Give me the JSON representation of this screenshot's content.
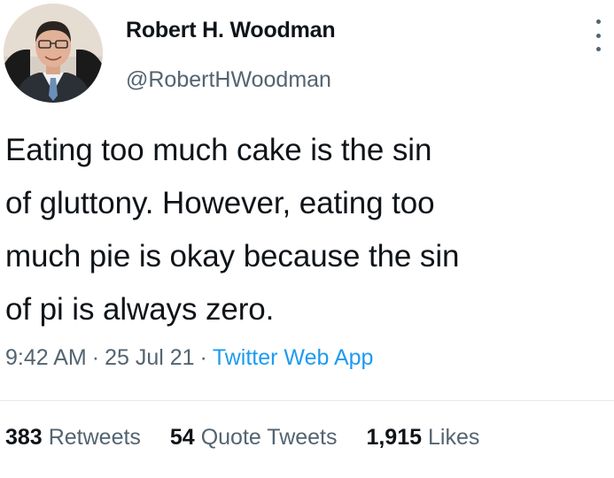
{
  "author": {
    "display_name": "Robert H. Woodman",
    "handle": "@RobertHWoodman",
    "avatar_icon": "profile-photo"
  },
  "tweet": {
    "lines": [
      "Eating too much cake is the sin",
      "of gluttony. However, eating too",
      "much pie is okay because the sin",
      "of pi is always zero."
    ],
    "time": "9:42 AM",
    "date": "25 Jul 21",
    "separator": "·",
    "source": "Twitter Web App"
  },
  "stats": {
    "retweets_count": "383",
    "retweets_label": "Retweets",
    "quote_count": "54",
    "quote_label": "Quote Tweets",
    "likes_count": "1,915",
    "likes_label": "Likes"
  },
  "colors": {
    "text_primary": "#0f1419",
    "text_secondary": "#536471",
    "link": "#1d9bf0",
    "divider": "#e6e9eb"
  }
}
